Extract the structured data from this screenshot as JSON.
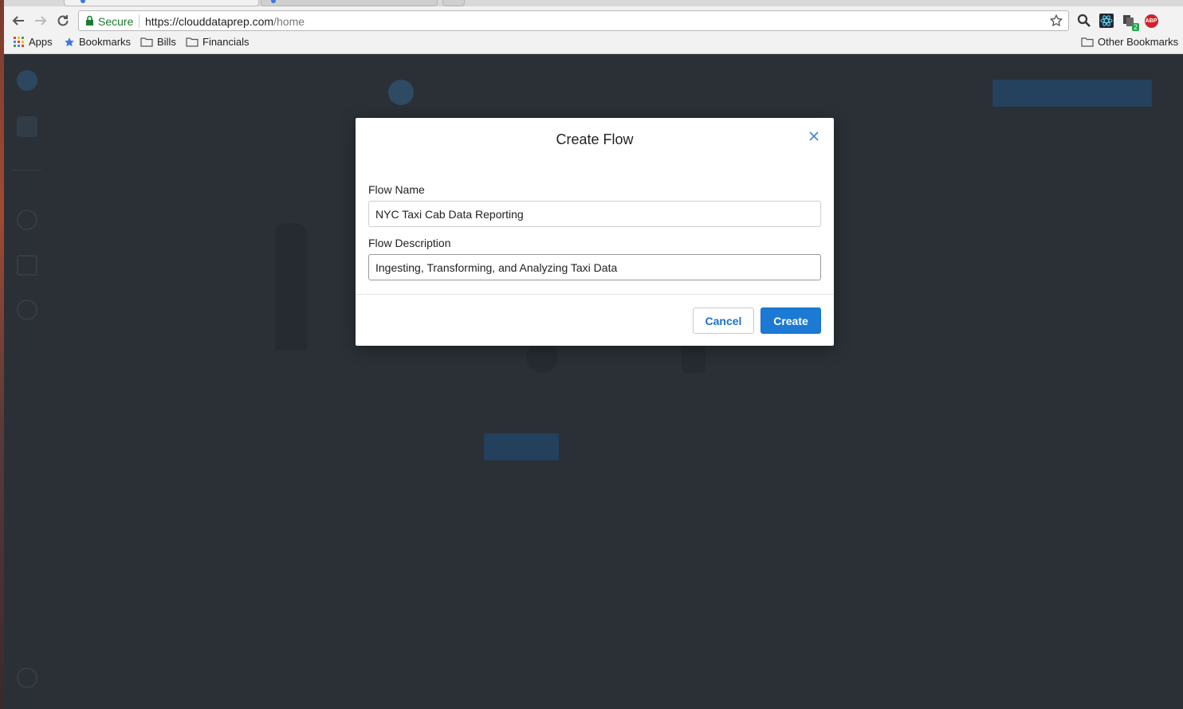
{
  "browser": {
    "secure_label": "Secure",
    "url_scheme_host": "https://clouddataprep.com",
    "url_path": "/home",
    "bookmarks": [
      {
        "label": "Apps",
        "icon": "apps-grid-icon"
      },
      {
        "label": "Bookmarks",
        "icon": "star-icon"
      },
      {
        "label": "Bills",
        "icon": "folder-icon"
      },
      {
        "label": "Financials",
        "icon": "folder-icon"
      }
    ],
    "other_bookmarks": "Other Bookmarks",
    "extension_badge": "2",
    "abp_label": "ABP"
  },
  "modal": {
    "title": "Create Flow",
    "flow_name_label": "Flow Name",
    "flow_name_value": "NYC Taxi Cab Data Reporting",
    "flow_description_label": "Flow Description",
    "flow_description_value": "Ingesting, Transforming, and Analyzing Taxi Data",
    "cancel_label": "Cancel",
    "create_label": "Create"
  },
  "colors": {
    "primary": "#1c7ad4",
    "backdrop": "#2a3036",
    "secure_green": "#1b7b2f"
  }
}
